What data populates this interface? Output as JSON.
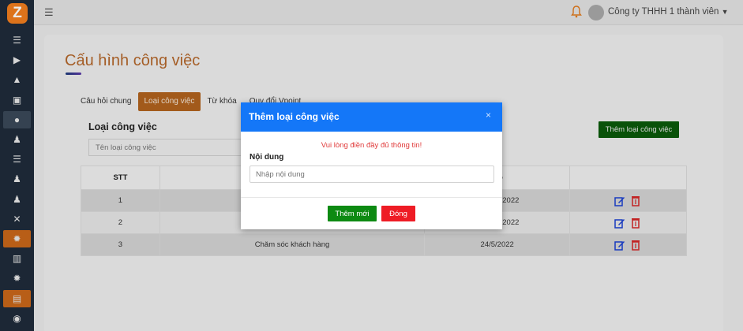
{
  "logo": {
    "letter": "Z"
  },
  "topbar": {
    "menu_icon": "hamburger-icon",
    "notification_icon": "bell-icon",
    "company_name": "Công ty THHH 1 thành viên",
    "dropdown_icon": "chevron-down-icon"
  },
  "sidebar": {
    "items": [
      {
        "icon": "list-icon",
        "glyph": "☰",
        "state": "normal"
      },
      {
        "icon": "play-icon",
        "glyph": "▶",
        "state": "normal"
      },
      {
        "icon": "chart-icon",
        "glyph": "▲",
        "state": "normal"
      },
      {
        "icon": "boxes-icon",
        "glyph": "▣",
        "state": "normal"
      },
      {
        "icon": "user-circle-icon",
        "glyph": "●",
        "state": "highlight"
      },
      {
        "icon": "user-plus-icon",
        "glyph": "♟",
        "state": "normal"
      },
      {
        "icon": "tasks-icon",
        "glyph": "☰",
        "state": "normal"
      },
      {
        "icon": "users-icon",
        "glyph": "♟",
        "state": "normal"
      },
      {
        "icon": "user-edit-icon",
        "glyph": "♟",
        "state": "normal"
      },
      {
        "icon": "user-slash-icon",
        "glyph": "✕",
        "state": "normal"
      },
      {
        "icon": "cog-icon",
        "glyph": "✹",
        "state": "active"
      },
      {
        "icon": "building-icon",
        "glyph": "▥",
        "state": "normal"
      },
      {
        "icon": "settings-icon",
        "glyph": "✹",
        "state": "normal"
      },
      {
        "icon": "database-icon",
        "glyph": "▤",
        "state": "active"
      },
      {
        "icon": "account-icon",
        "glyph": "◉",
        "state": "normal"
      }
    ]
  },
  "page": {
    "title": "Cấu hình công việc",
    "tabs": [
      {
        "label": "Câu hỏi chung",
        "active": false
      },
      {
        "label": "Loại công việc",
        "active": true
      },
      {
        "label": "Từ khóa",
        "active": false
      },
      {
        "label": "Quy đổi Vpoint",
        "active": false
      }
    ],
    "section_title": "Loại công việc",
    "search_placeholder": "Tên loại công việc",
    "add_button": "Thêm loại công việc"
  },
  "table": {
    "headers": [
      "STT",
      "",
      "tạo",
      ""
    ],
    "rows": [
      {
        "stt": "1",
        "name": "",
        "date": "2022"
      },
      {
        "stt": "2",
        "name": "",
        "date": "2022"
      },
      {
        "stt": "3",
        "name": "Chăm sóc khách hàng",
        "date": "24/5/2022"
      }
    ]
  },
  "modal": {
    "title": "Thêm loại công việc",
    "close_glyph": "×",
    "error": "Vui lòng điền đầy đủ thông tin!",
    "field_label": "Nội dung",
    "field_placeholder": "Nhập nội dung",
    "field_value": "",
    "submit_label": "Thêm mới",
    "cancel_label": "Đóng"
  },
  "colors": {
    "accent": "#1477f8",
    "brand_orange": "#c8661a",
    "sidebar_bg": "#1f2b3a",
    "success": "#0d8a12",
    "danger": "#ee1c25",
    "edit_icon": "#1a3fd0",
    "delete_icon": "#d32626"
  }
}
